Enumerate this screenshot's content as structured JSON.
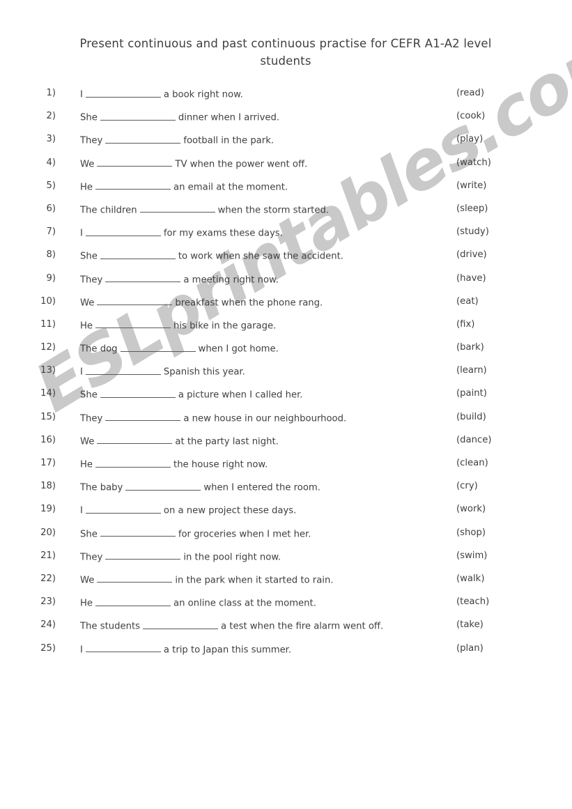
{
  "document": {
    "title_line_1": "Present continuous and past continuous practise for CEFR A1-A2 level",
    "title_line_2": "students",
    "watermark": "ESLprintables.com",
    "text_color": "#3f3f3f",
    "watermark_color": "#c9c9c9",
    "background_color": "#ffffff"
  },
  "exercises": [
    {
      "number": "1)",
      "before": "I",
      "after": "a book right now.",
      "verb": "(read)"
    },
    {
      "number": "2)",
      "before": "She",
      "after": "dinner when I arrived.",
      "verb": "(cook)"
    },
    {
      "number": "3)",
      "before": "They",
      "after": "football in the park.",
      "verb": "(play)"
    },
    {
      "number": "4)",
      "before": "We",
      "after": "TV when the power went off.",
      "verb": "(watch)"
    },
    {
      "number": "5)",
      "before": "He",
      "after": "an email at the moment.",
      "verb": "(write)"
    },
    {
      "number": "6)",
      "before": "The children",
      "after": "when the storm started.",
      "verb": "(sleep)"
    },
    {
      "number": "7)",
      "before": "I",
      "after": "for my exams these days.",
      "verb": "(study)"
    },
    {
      "number": "8)",
      "before": "She",
      "after": "to work when she saw the accident.",
      "verb": "(drive)"
    },
    {
      "number": "9)",
      "before": "They",
      "after": "a meeting right now.",
      "verb": "(have)"
    },
    {
      "number": "10)",
      "before": "We",
      "after": "breakfast when the phone rang.",
      "verb": "(eat)"
    },
    {
      "number": "11)",
      "before": "He",
      "after": "his bike in the garage.",
      "verb": "(fix)"
    },
    {
      "number": "12)",
      "before": "The dog",
      "after": "when I got home.",
      "verb": "(bark)"
    },
    {
      "number": "13)",
      "before": "I",
      "after": "Spanish this year.",
      "verb": "(learn)"
    },
    {
      "number": "14)",
      "before": "She",
      "after": "a picture when I called her.",
      "verb": "(paint)"
    },
    {
      "number": "15)",
      "before": "They",
      "after": "a new house in our neighbourhood.",
      "verb": "(build)"
    },
    {
      "number": "16)",
      "before": "We",
      "after": "at the party last night.",
      "verb": "(dance)"
    },
    {
      "number": "17)",
      "before": "He",
      "after": "the house right now.",
      "verb": "(clean)"
    },
    {
      "number": "18)",
      "before": "The baby",
      "after": "when I entered the room.",
      "verb": "(cry)"
    },
    {
      "number": "19)",
      "before": "I",
      "after": "on a new project these days.",
      "verb": "(work)"
    },
    {
      "number": "20)",
      "before": "She",
      "after": "for groceries when I met her.",
      "verb": "(shop)"
    },
    {
      "number": "21)",
      "before": "They",
      "after": "in the pool right now.",
      "verb": "(swim)"
    },
    {
      "number": "22)",
      "before": "We",
      "after": "in the park when it started to rain.",
      "verb": "(walk)"
    },
    {
      "number": "23)",
      "before": "He",
      "after": "an online class at the moment.",
      "verb": "(teach)"
    },
    {
      "number": "24)",
      "before": "The students",
      "after": "a test when the fire alarm went off.",
      "verb": "(take)"
    },
    {
      "number": "25)",
      "before": "I",
      "after": "a trip to Japan this summer.",
      "verb": "(plan)"
    }
  ],
  "blank_widths": {
    "default": 108
  }
}
